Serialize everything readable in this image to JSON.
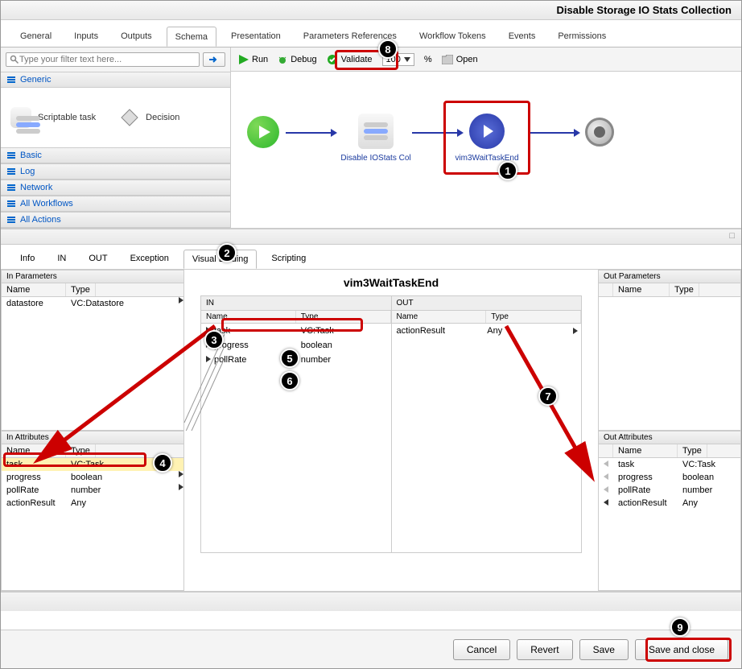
{
  "window_title": "Disable Storage IO Stats Collection",
  "top_tabs": [
    "General",
    "Inputs",
    "Outputs",
    "Schema",
    "Presentation",
    "Parameters References",
    "Workflow Tokens",
    "Events",
    "Permissions"
  ],
  "active_top_tab": "Schema",
  "filter_placeholder": "Type your filter text here...",
  "palette_categories": {
    "generic": "Generic",
    "basic": "Basic",
    "log": "Log",
    "network": "Network",
    "all_workflows": "All Workflows",
    "all_actions": "All Actions"
  },
  "palette_items": {
    "scriptable_task": "Scriptable task",
    "decision": "Decision"
  },
  "toolbar": {
    "run": "Run",
    "debug": "Debug",
    "validate": "Validate",
    "zoom": "100",
    "percent": "%",
    "open": "Open"
  },
  "wf_nodes": {
    "script_label": "Disable IOStats Col",
    "gear_label": "vim3WaitTaskEnd"
  },
  "mid_tabs": [
    "Info",
    "IN",
    "OUT",
    "Exception",
    "Visual Binding",
    "Scripting"
  ],
  "active_mid_tab": "Visual Binding",
  "binding": {
    "title": "vim3WaitTaskEnd",
    "in_params": {
      "header": "In Parameters",
      "col_name": "Name",
      "col_type": "Type",
      "rows": [
        {
          "name": "datastore",
          "type": "VC:Datastore"
        }
      ]
    },
    "in_attrs": {
      "header": "In Attributes",
      "col_name": "Name",
      "col_type": "Type",
      "rows": [
        {
          "name": "task",
          "type": "VC:Task"
        },
        {
          "name": "progress",
          "type": "boolean"
        },
        {
          "name": "pollRate",
          "type": "number"
        },
        {
          "name": "actionResult",
          "type": "Any"
        }
      ]
    },
    "in_box": {
      "header": "IN",
      "col_name": "Name",
      "col_type": "Type",
      "rows": [
        {
          "name": "task",
          "type": "VC:Task"
        },
        {
          "name": "progress",
          "type": "boolean"
        },
        {
          "name": "pollRate",
          "type": "number"
        }
      ]
    },
    "out_box": {
      "header": "OUT",
      "col_name": "Name",
      "col_type": "Type",
      "rows": [
        {
          "name": "actionResult",
          "type": "Any"
        }
      ]
    },
    "out_params": {
      "header": "Out Parameters",
      "col_name": "Name",
      "col_type": "Type"
    },
    "out_attrs": {
      "header": "Out Attributes",
      "col_name": "Name",
      "col_type": "Type",
      "rows": [
        {
          "name": "task",
          "type": "VC:Task"
        },
        {
          "name": "progress",
          "type": "boolean"
        },
        {
          "name": "pollRate",
          "type": "number"
        },
        {
          "name": "actionResult",
          "type": "Any"
        }
      ]
    }
  },
  "buttons": {
    "cancel": "Cancel",
    "revert": "Revert",
    "save": "Save",
    "save_close": "Save and close"
  },
  "callouts": {
    "c1": "1",
    "c2": "2",
    "c3": "3",
    "c4": "4",
    "c5": "5",
    "c6": "6",
    "c7": "7",
    "c8": "8",
    "c9": "9"
  }
}
